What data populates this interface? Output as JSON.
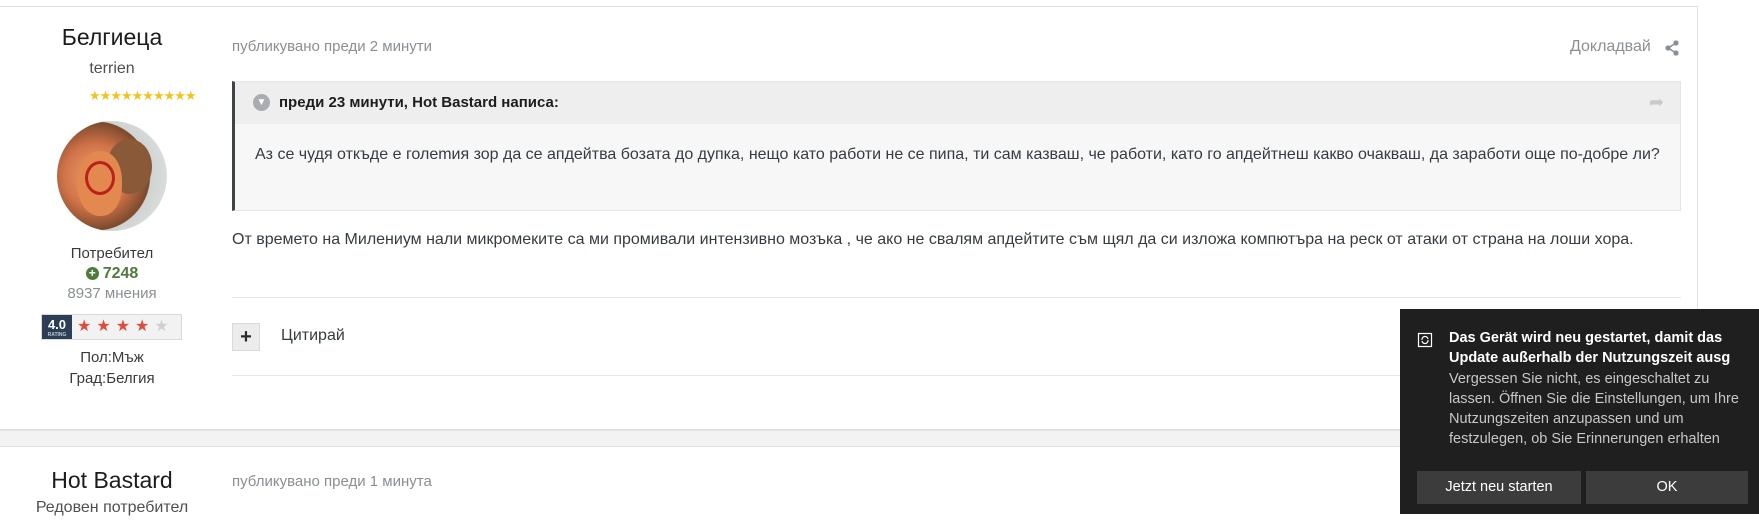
{
  "post1": {
    "author": "Белгиеца",
    "title": "terrien",
    "rank_stars": 10,
    "group": "Потребител",
    "reputation": "7248",
    "posts": "8937 мнения",
    "rating": {
      "score": "4.0",
      "score_caption": "RATING",
      "stars": 4,
      "max": 5
    },
    "gender": "Пол:Мъж",
    "city": "Град:Белгия",
    "timestamp": "публикувано преди 2 минути",
    "report_label": "Докладвай",
    "quote": {
      "title": "преди 23 минути, Hot Bastard написа:",
      "text": "Аз се чудя откъде е голemия зор да се апдейтва бозата до дупка, нещо като работи не се пипа, ти сам казваш, че работи, като го апдейтнеш какво очакваш, да заработи още по-добре ли?"
    },
    "body": "От времето на Милениум нали микромеките са ми промивали интензивно мозъка , че ако не свалям апдейтите съм щял да си изложа компютъра на реск от атаки от страна на лоши хора.",
    "quote_button_symbol": "+",
    "cite_label": "Цитирай"
  },
  "post2": {
    "author": "Hot Bastard",
    "group": "Редовен потребител",
    "timestamp": "публикувано преди 1 минута"
  },
  "toast": {
    "title": "Das Gerät wird neu gestartet, damit das Update außerhalb der Nutzungszeit ausg",
    "message": "Vergessen Sie nicht, es eingeschaltet zu lassen. Öffnen Sie die Einstellungen, um Ihre Nutzungszeiten anzupassen und um festzulegen, ob Sie Erinnerungen erhalten",
    "restart_label": "Jetzt neu starten",
    "ok_label": "OK"
  },
  "colors": {
    "reputation": "#4f7a3c",
    "rating_star": "#e14b3b",
    "rank_star": "#f0c419",
    "toast_bg": "#1f1f1f"
  }
}
